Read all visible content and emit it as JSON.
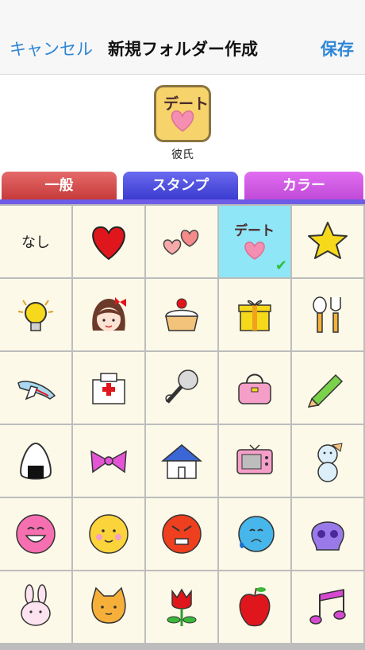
{
  "nav": {
    "cancel_label": "キャンセル",
    "title": "新規フォルダー作成",
    "save_label": "保存"
  },
  "folder": {
    "name": "彼氏",
    "icon_text": "デート",
    "icon": "date-heart-stamp-icon"
  },
  "tabs": [
    {
      "label": "一般",
      "color": "#d94b4b"
    },
    {
      "label": "スタンプ",
      "color": "#4a4ae0",
      "active": true
    },
    {
      "label": "カラー",
      "color": "#d05ce6"
    }
  ],
  "stamp_none_label": "なし",
  "stamp_date_text": "デート",
  "stamps": [
    "none",
    "heart-icon",
    "two-hearts-icon",
    "date-heart-icon",
    "star-icon",
    "light-bulb-icon",
    "girl-face-icon",
    "strawberry-cake-icon",
    "gift-box-icon",
    "spoon-fork-icon",
    "airplane-icon",
    "hospital-icon",
    "microphone-icon",
    "handbag-icon",
    "pencil-icon",
    "rice-ball-icon",
    "ribbon-icon",
    "house-icon",
    "television-icon",
    "snowman-icon",
    "laughing-face-icon",
    "blushing-face-icon",
    "angry-face-icon",
    "crying-face-icon",
    "skull-icon",
    "rabbit-icon",
    "cat-icon",
    "tulip-icon",
    "apple-icon",
    "music-note-icon"
  ],
  "selected_stamp": "date-heart-icon"
}
